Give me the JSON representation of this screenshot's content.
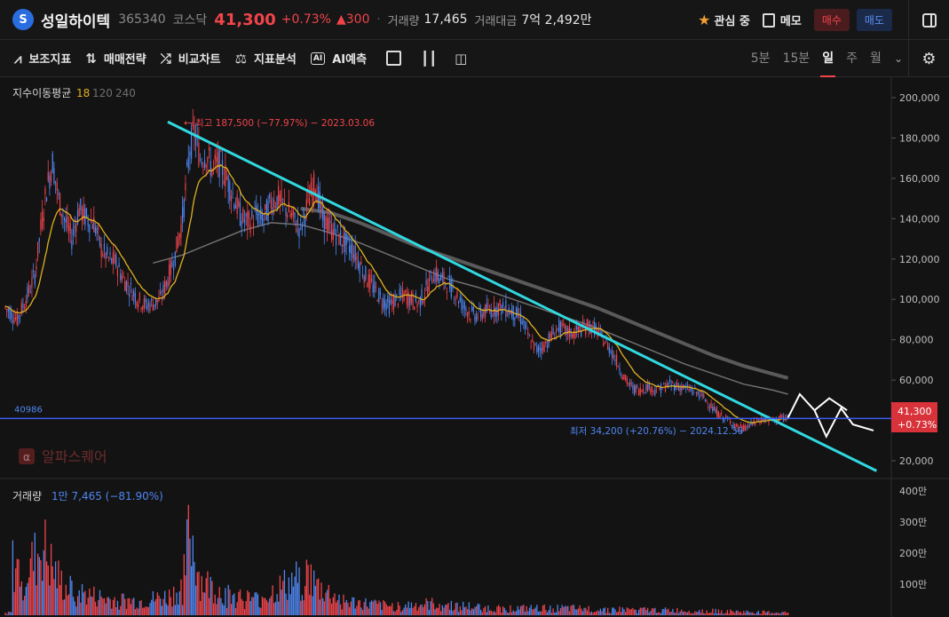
{
  "header": {
    "logo_glyph": "S",
    "name": "성일하이텍",
    "code": "365340",
    "market": "코스닥",
    "price": "41,300",
    "change_pct": "+0.73%",
    "change": "▲300",
    "volume_label": "거래량",
    "volume": "17,465",
    "amount_label": "거래대금",
    "amount": "7억 2,492만",
    "watch_label": "관심 중",
    "memo_label": "메모",
    "buy_label": "매수",
    "sell_label": "매도"
  },
  "toolbar": {
    "items": [
      "보조지표",
      "매매전략",
      "비교차트",
      "지표분석",
      "AI예측"
    ],
    "ai_icon_text": "AI",
    "periods": [
      "5분",
      "15분",
      "일",
      "주",
      "월"
    ],
    "active_period": "일"
  },
  "colors": {
    "up": "#f0444b",
    "down": "#4f86f0",
    "ma18": "#e0b020",
    "ma120": "#707070",
    "ma240": "#5a5a5a",
    "trendline": "#31d8e0",
    "prediction": "#ffffff",
    "hline": "#3a5cf0"
  },
  "chart_data": {
    "type": "candlestick",
    "ma_legend": {
      "label": "지수이동평균",
      "values": [
        "18",
        "120",
        "240"
      ]
    },
    "y_ticks": [
      "200,000",
      "180,000",
      "160,000",
      "140,000",
      "120,000",
      "100,000",
      "80,000",
      "60,000",
      "40,000",
      "20,000"
    ],
    "ylim": [
      20000,
      200000
    ],
    "high_annotation": "최고 187,500 (−77.97%) − 2023.03.06",
    "low_annotation": "최저 34,200 (+20.76%) − 2024.12.30",
    "hline_value_label": "40986",
    "current_price_label": "41,300",
    "current_pct_label": "+0.73%",
    "watermark": "알파스퀘어",
    "watermark_glyph": "α",
    "price_path": [
      [
        0,
        96000
      ],
      [
        8,
        90000
      ],
      [
        14,
        100000
      ],
      [
        20,
        112000
      ],
      [
        24,
        135000
      ],
      [
        28,
        155000
      ],
      [
        32,
        168000
      ],
      [
        36,
        150000
      ],
      [
        40,
        140000
      ],
      [
        45,
        130000
      ],
      [
        50,
        145000
      ],
      [
        55,
        140000
      ],
      [
        60,
        138000
      ],
      [
        65,
        125000
      ],
      [
        70,
        120000
      ],
      [
        75,
        118000
      ],
      [
        80,
        110000
      ],
      [
        85,
        105000
      ],
      [
        90,
        100000
      ],
      [
        95,
        97000
      ],
      [
        100,
        98000
      ],
      [
        105,
        100000
      ],
      [
        110,
        110000
      ],
      [
        115,
        122000
      ],
      [
        120,
        140000
      ],
      [
        125,
        175000
      ],
      [
        128,
        183000
      ],
      [
        132,
        170000
      ],
      [
        136,
        172000
      ],
      [
        140,
        165000
      ],
      [
        145,
        168000
      ],
      [
        150,
        160000
      ],
      [
        155,
        150000
      ],
      [
        160,
        140000
      ],
      [
        165,
        138000
      ],
      [
        170,
        142000
      ],
      [
        175,
        140000
      ],
      [
        180,
        148000
      ],
      [
        185,
        150000
      ],
      [
        190,
        145000
      ],
      [
        195,
        140000
      ],
      [
        200,
        135000
      ],
      [
        205,
        148000
      ],
      [
        210,
        158000
      ],
      [
        215,
        140000
      ],
      [
        220,
        135000
      ],
      [
        225,
        132000
      ],
      [
        230,
        128000
      ],
      [
        235,
        125000
      ],
      [
        240,
        118000
      ],
      [
        245,
        110000
      ],
      [
        250,
        105000
      ],
      [
        255,
        100000
      ],
      [
        260,
        97000
      ],
      [
        265,
        100000
      ],
      [
        270,
        102000
      ],
      [
        275,
        100000
      ],
      [
        280,
        98000
      ],
      [
        285,
        105000
      ],
      [
        290,
        113000
      ],
      [
        295,
        110000
      ],
      [
        300,
        108000
      ],
      [
        305,
        103000
      ],
      [
        310,
        97000
      ],
      [
        315,
        93000
      ],
      [
        320,
        92000
      ],
      [
        325,
        94000
      ],
      [
        330,
        95000
      ],
      [
        335,
        96000
      ],
      [
        340,
        95000
      ],
      [
        345,
        93000
      ],
      [
        350,
        90000
      ],
      [
        355,
        80000
      ],
      [
        360,
        75000
      ],
      [
        365,
        77000
      ],
      [
        370,
        82000
      ],
      [
        375,
        86000
      ],
      [
        380,
        84000
      ],
      [
        385,
        83000
      ],
      [
        390,
        85000
      ],
      [
        395,
        87000
      ],
      [
        400,
        85000
      ],
      [
        405,
        80000
      ],
      [
        410,
        75000
      ],
      [
        415,
        68000
      ],
      [
        420,
        60000
      ],
      [
        425,
        56000
      ],
      [
        430,
        55000
      ],
      [
        435,
        57000
      ],
      [
        440,
        55000
      ],
      [
        445,
        56000
      ],
      [
        450,
        58000
      ],
      [
        455,
        57000
      ],
      [
        460,
        56000
      ],
      [
        465,
        55000
      ],
      [
        470,
        53000
      ],
      [
        475,
        50000
      ],
      [
        480,
        45000
      ],
      [
        485,
        42000
      ],
      [
        490,
        40000
      ],
      [
        495,
        37000
      ],
      [
        500,
        36000
      ],
      [
        505,
        38000
      ],
      [
        510,
        40000
      ],
      [
        515,
        40500
      ],
      [
        520,
        40000
      ],
      [
        525,
        41000
      ],
      [
        530,
        41300
      ]
    ],
    "ma120_path": [
      [
        100,
        118000
      ],
      [
        120,
        122000
      ],
      [
        140,
        128000
      ],
      [
        160,
        134000
      ],
      [
        180,
        138000
      ],
      [
        200,
        137000
      ],
      [
        220,
        133000
      ],
      [
        240,
        128000
      ],
      [
        260,
        122000
      ],
      [
        280,
        116000
      ],
      [
        300,
        110000
      ],
      [
        320,
        106000
      ],
      [
        340,
        101000
      ],
      [
        360,
        96000
      ],
      [
        380,
        91000
      ],
      [
        400,
        86000
      ],
      [
        420,
        80000
      ],
      [
        440,
        74000
      ],
      [
        460,
        68000
      ],
      [
        480,
        63000
      ],
      [
        500,
        58000
      ],
      [
        520,
        55000
      ],
      [
        530,
        53000
      ]
    ],
    "ma240_path": [
      [
        200,
        145000
      ],
      [
        220,
        143000
      ],
      [
        240,
        138000
      ],
      [
        260,
        132000
      ],
      [
        280,
        126000
      ],
      [
        300,
        121000
      ],
      [
        320,
        116000
      ],
      [
        340,
        111000
      ],
      [
        360,
        106000
      ],
      [
        380,
        101000
      ],
      [
        400,
        96000
      ],
      [
        420,
        90000
      ],
      [
        440,
        84000
      ],
      [
        460,
        78000
      ],
      [
        480,
        72000
      ],
      [
        500,
        67000
      ],
      [
        520,
        63000
      ],
      [
        530,
        61000
      ]
    ],
    "trendline": [
      [
        110,
        188000
      ],
      [
        590,
        15000
      ]
    ],
    "prediction_path": [
      [
        530,
        41300
      ],
      [
        538,
        53000
      ],
      [
        548,
        45000
      ],
      [
        556,
        32000
      ],
      [
        566,
        46000
      ],
      [
        574,
        38000
      ],
      [
        588,
        35000
      ]
    ],
    "prediction_path2": [
      [
        548,
        45000
      ],
      [
        558,
        51000
      ],
      [
        570,
        45000
      ]
    ],
    "volume_legend": {
      "label": "거래량",
      "value": "1만 7,465 (−81.90%)"
    },
    "volume_ticks": [
      "400만",
      "300만",
      "200만",
      "100만"
    ],
    "volume_ylim": [
      0,
      4000000
    ],
    "volume_peaks": [
      [
        5,
        2200000
      ],
      [
        12,
        1800000
      ],
      [
        20,
        2400000
      ],
      [
        25,
        3100000
      ],
      [
        28,
        2600000
      ],
      [
        32,
        2000000
      ],
      [
        40,
        1200000
      ],
      [
        55,
        900000
      ],
      [
        70,
        700000
      ],
      [
        90,
        600000
      ],
      [
        110,
        800000
      ],
      [
        120,
        1200000
      ],
      [
        125,
        3800000
      ],
      [
        128,
        2800000
      ],
      [
        132,
        1500000
      ],
      [
        150,
        900000
      ],
      [
        170,
        700000
      ],
      [
        205,
        1800000
      ],
      [
        210,
        1300000
      ],
      [
        230,
        600000
      ],
      [
        260,
        400000
      ],
      [
        290,
        500000
      ],
      [
        330,
        300000
      ],
      [
        380,
        300000
      ],
      [
        420,
        250000
      ],
      [
        470,
        200000
      ],
      [
        500,
        150000
      ],
      [
        520,
        120000
      ]
    ]
  }
}
